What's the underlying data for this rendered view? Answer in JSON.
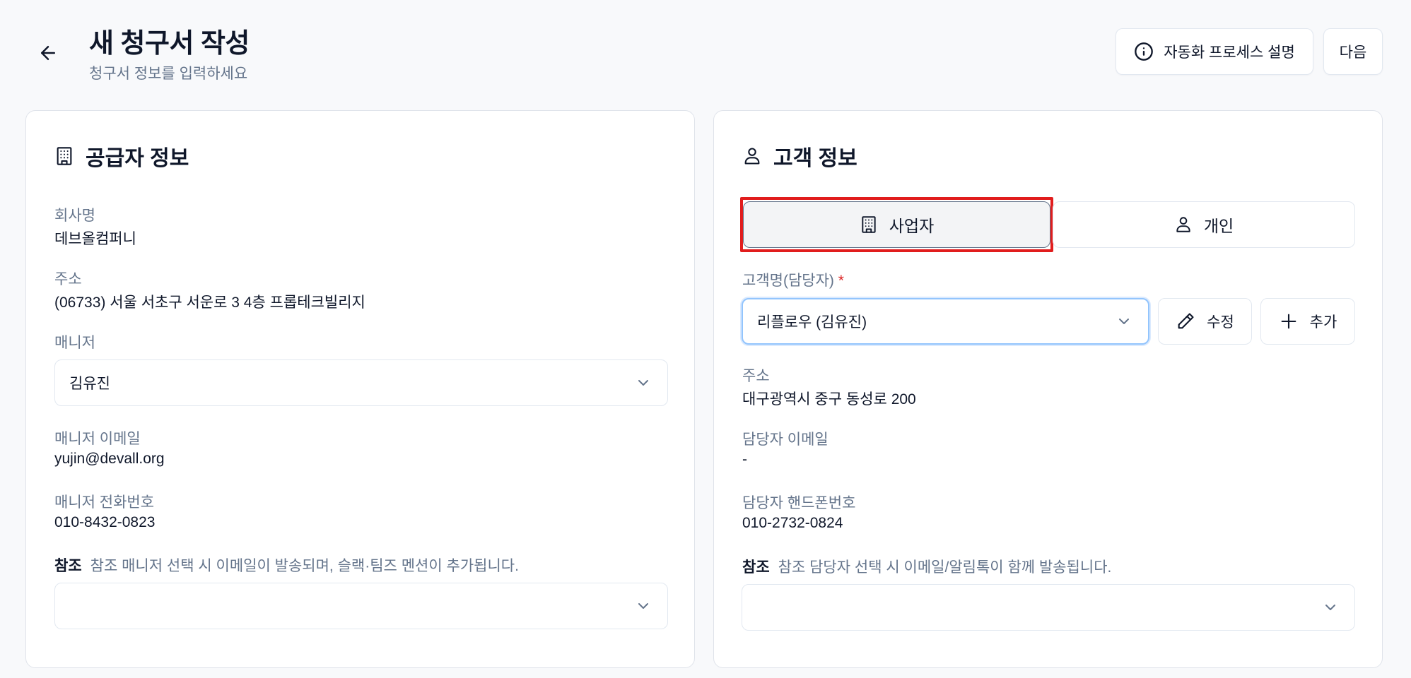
{
  "header": {
    "title": "새 청구서 작성",
    "subtitle": "청구서 정보를 입력하세요",
    "help_label": "자동화 프로세스 설명",
    "next_label": "다음"
  },
  "supplier": {
    "title": "공급자 정보",
    "company_label": "회사명",
    "company_value": "데브올컴퍼니",
    "address_label": "주소",
    "address_value": "(06733) 서울 서초구 서운로 3 4층 프롭테크빌리지",
    "manager_label": "매니저",
    "manager_value": "김유진",
    "email_label": "매니저 이메일",
    "email_value": "yujin@devall.org",
    "phone_label": "매니저 전화번호",
    "phone_value": "010-8432-0823",
    "ref_strong": "참조",
    "ref_text": "참조 매니저 선택 시 이메일이 발송되며, 슬랙·팀즈 멘션이 추가됩니다.",
    "ref_value": ""
  },
  "customer": {
    "title": "고객 정보",
    "type_business": "사업자",
    "type_individual": "개인",
    "selected_type": "사업자",
    "name_label": "고객명(담당자)",
    "required_mark": "*",
    "name_value": "리플로우 (김유진)",
    "edit_label": "수정",
    "add_label": "추가",
    "address_label": "주소",
    "address_value": "대구광역시 중구 동성로 200",
    "email_label": "담당자 이메일",
    "email_value": "-",
    "phone_label": "담당자 핸드폰번호",
    "phone_value": "010-2732-0824",
    "ref_strong": "참조",
    "ref_text": "참조 담당자 선택 시 이메일/알림톡이 함께 발송됩니다.",
    "ref_value": ""
  },
  "colors": {
    "highlight": "#e11d1d",
    "required": "#dc2626",
    "focus_ring": "#93c5fd"
  },
  "icons": [
    "arrow-left-icon",
    "info-circle-icon",
    "building-icon",
    "user-icon",
    "chevron-down-icon",
    "pencil-icon",
    "plus-icon"
  ]
}
